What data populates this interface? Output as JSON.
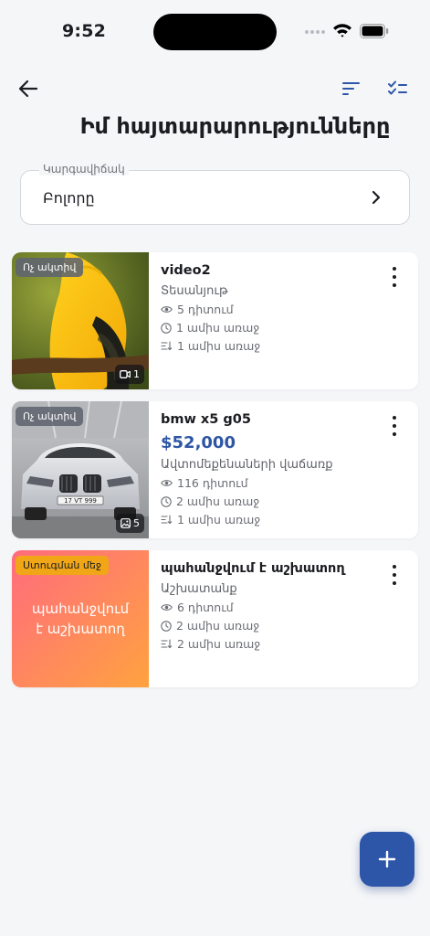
{
  "status_bar": {
    "time": "9:52"
  },
  "header": {
    "title": "Իմ հայտարարությունները",
    "back_icon": "arrow-left-icon",
    "sort_icon": "sort-icon",
    "select_icon": "checklist-icon"
  },
  "filter": {
    "label": "Կարգավիճակ",
    "value": "Բոլորը"
  },
  "listings": [
    {
      "title": "video2",
      "badge": "Ոչ ակտիվ",
      "category": "Տեսանյութ",
      "views": "5 դիտում",
      "created": "1 ամիս առաջ",
      "updated": "1 ամիս առաջ",
      "media_count": "1",
      "media_icon": "video-icon"
    },
    {
      "title": "bmw x5 g05",
      "price": "$52,000",
      "badge": "Ոչ ակտիվ",
      "category": "Ավտոմեքենաների վաճառք",
      "views": "116 դիտում",
      "created": "2 ամիս առաջ",
      "updated": "1 ամիս առաջ",
      "media_count": "5",
      "media_icon": "image-icon",
      "plate_text": "17 VT 999"
    },
    {
      "title": "պահանջվում է աշխատող",
      "badge": "Ստուգման մեջ",
      "thumb_text": "պահանջվում է աշխատող",
      "category": "Աշխատանք",
      "views": "6 դիտում",
      "created": "2 ամիս առաջ",
      "updated": "2 ամիս առաջ"
    }
  ],
  "fab": {
    "icon": "plus-icon"
  },
  "colors": {
    "accent": "#2d56a8",
    "price": "#2e56a4",
    "badge_inactive": "#5f6470",
    "badge_review": "#f0a617",
    "background": "#f5f6f8"
  }
}
